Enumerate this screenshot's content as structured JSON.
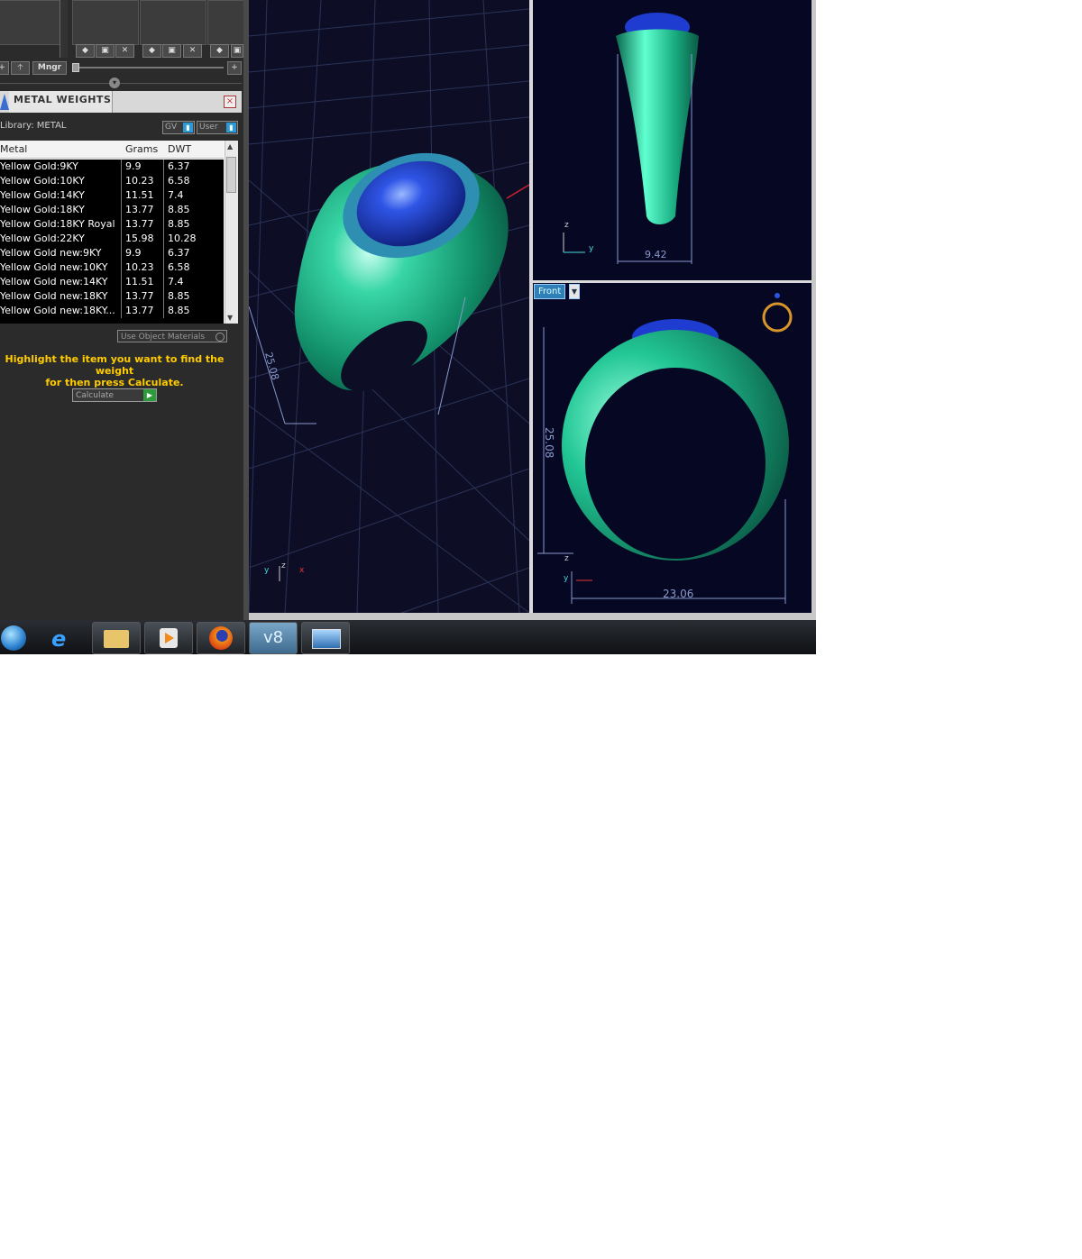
{
  "toolbar": {
    "mngr_label": "Mngr"
  },
  "panel": {
    "title": "METAL WEIGHTS",
    "close": "×",
    "library_label": "Library: METAL",
    "gv_label": "GV",
    "user_label": "User",
    "columns": [
      "Metal",
      "Grams",
      "DWT"
    ],
    "rows": [
      {
        "metal": "Yellow Gold:9KY",
        "grams": "9.9",
        "dwt": "6.37"
      },
      {
        "metal": "Yellow Gold:10KY",
        "grams": "10.23",
        "dwt": "6.58"
      },
      {
        "metal": "Yellow Gold:14KY",
        "grams": "11.51",
        "dwt": "7.4"
      },
      {
        "metal": "Yellow Gold:18KY",
        "grams": "13.77",
        "dwt": "8.85"
      },
      {
        "metal": "Yellow Gold:18KY Royal",
        "grams": "13.77",
        "dwt": "8.85"
      },
      {
        "metal": "Yellow Gold:22KY",
        "grams": "15.98",
        "dwt": "10.28"
      },
      {
        "metal": "Yellow Gold new:9KY",
        "grams": "9.9",
        "dwt": "6.37"
      },
      {
        "metal": "Yellow Gold new:10KY",
        "grams": "10.23",
        "dwt": "6.58"
      },
      {
        "metal": "Yellow Gold new:14KY",
        "grams": "11.51",
        "dwt": "7.4"
      },
      {
        "metal": "Yellow Gold new:18KY",
        "grams": "13.77",
        "dwt": "8.85"
      },
      {
        "metal": "Yellow Gold new:18KY...",
        "grams": "13.77",
        "dwt": "8.85"
      }
    ],
    "use_object_materials": "Use Object Materials",
    "hint_line1": "Highlight the item you want to find the weight",
    "hint_line2": "for then press Calculate.",
    "calculate_label": "Calculate"
  },
  "viewports": {
    "perspective": {
      "dim_height": "25.08",
      "axis_y": "y",
      "axis_z": "z",
      "axis_x": "x"
    },
    "side": {
      "dim_width": "9.42",
      "axis_z": "z",
      "axis_y": "y"
    },
    "front": {
      "view_label": "Front",
      "dim_height": "25.08",
      "dim_width": "23.06",
      "axis_z": "z",
      "axis_y": "y"
    }
  },
  "colors": {
    "ring": "#1fc28f",
    "gem": "#1e3ccf",
    "table_row": "#000000",
    "hint": "#ffcc00"
  },
  "taskbar": {
    "items": [
      "start-orb-icon",
      "internet-explorer-icon",
      "file-explorer-icon",
      "media-player-icon",
      "firefox-icon",
      "v8-app-icon",
      "picture-viewer-icon"
    ],
    "v8_label": "v8"
  }
}
